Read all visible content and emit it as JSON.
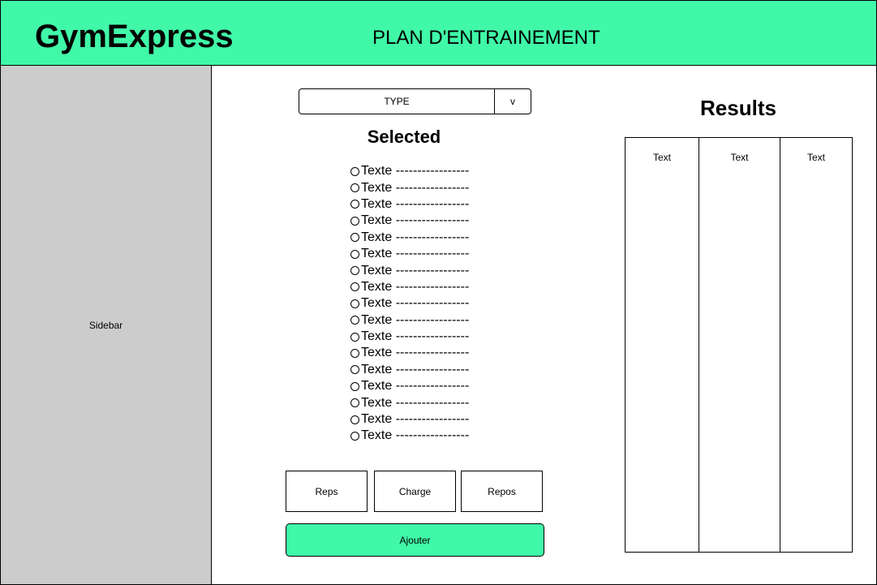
{
  "header": {
    "logo": "GymExpress",
    "title": "PLAN D'ENTRAINEMENT"
  },
  "sidebar": {
    "label": "Sidebar"
  },
  "type_select": {
    "selected": "TYPE",
    "arrow": "v"
  },
  "selected": {
    "title": "Selected",
    "items": [
      "Texte -----------------",
      "Texte -----------------",
      "Texte -----------------",
      "Texte -----------------",
      "Texte -----------------",
      "Texte -----------------",
      "Texte -----------------",
      "Texte -----------------",
      "Texte -----------------",
      "Texte -----------------",
      "Texte -----------------",
      "Texte -----------------",
      "Texte -----------------",
      "Texte -----------------",
      "Texte -----------------",
      "Texte -----------------",
      "Texte -----------------"
    ]
  },
  "fields": {
    "reps": "Reps",
    "charge": "Charge",
    "repos": "Repos"
  },
  "add_button": "Ajouter",
  "results": {
    "title": "Results",
    "columns": [
      "Text",
      "Text",
      "Text"
    ]
  },
  "colors": {
    "accent": "#40f8a8",
    "sidebar": "#cccccc"
  }
}
